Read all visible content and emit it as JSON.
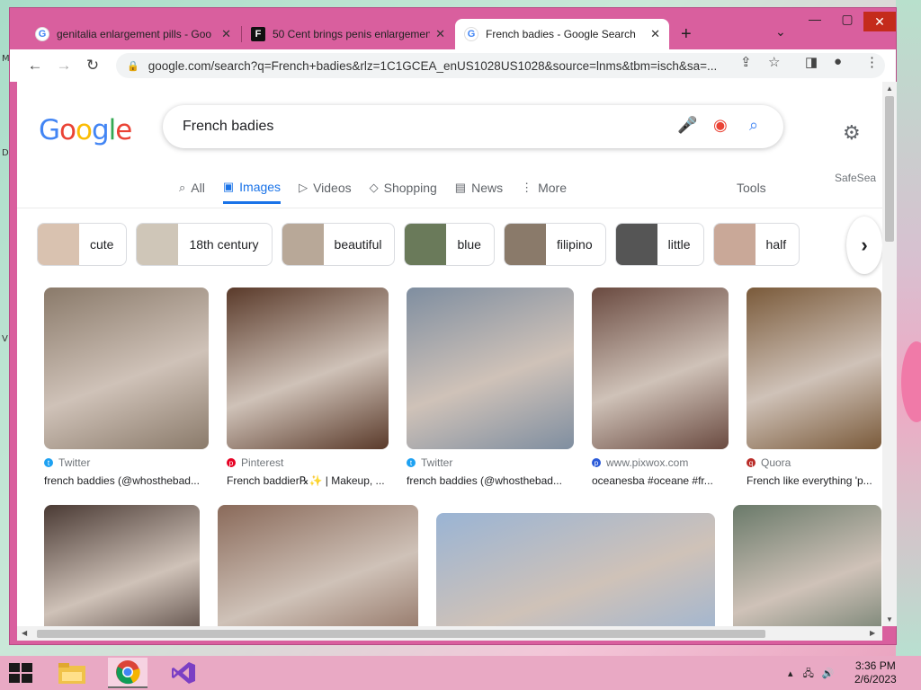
{
  "browser": {
    "tabs": [
      {
        "title": "genitalia enlargement pills - Goo",
        "favicon": "google-icon",
        "active": false
      },
      {
        "title": "50 Cent brings penis enlargemen",
        "favicon": "f-site-icon",
        "active": false
      },
      {
        "title": "French badies - Google Search",
        "favicon": "google-icon",
        "active": true
      }
    ],
    "new_tab": "+",
    "url": "google.com/search?q=French+badies&rlz=1C1GCEA_enUS1028US1028&source=lnms&tbm=isch&sa=..."
  },
  "google": {
    "logo": "Google",
    "query": "French badies",
    "nav_tabs": [
      {
        "label": "All",
        "icon": "search-icon",
        "selected": false
      },
      {
        "label": "Images",
        "icon": "image-icon",
        "selected": true
      },
      {
        "label": "Videos",
        "icon": "play-icon",
        "selected": false
      },
      {
        "label": "Shopping",
        "icon": "tag-icon",
        "selected": false
      },
      {
        "label": "News",
        "icon": "news-icon",
        "selected": false
      },
      {
        "label": "More",
        "icon": "more-vert-icon",
        "selected": false
      }
    ],
    "tools": "Tools",
    "safesearch": "SafeSea",
    "chips": [
      "cute",
      "18th century",
      "beautiful",
      "blue",
      "filipino",
      "little",
      "half"
    ],
    "results_row1": [
      {
        "source": "Twitter",
        "caption": "french baddies (@whosthebad...",
        "color": "#8a7a6a"
      },
      {
        "source": "Pinterest",
        "caption": "French baddier℞✨ | Makeup, ...",
        "color": "#5a3a2a"
      },
      {
        "source": "Twitter",
        "caption": "french baddies (@whosthebad...",
        "color": "#7f8ea0"
      },
      {
        "source": "www.pixwox.com",
        "caption": "oceanesba #oceane #fr...",
        "color": "#6a4a40"
      },
      {
        "source": "Quora",
        "caption": "French like everything 'p...",
        "color": "#7a5a3a"
      }
    ],
    "results_row2": [
      {
        "color": "#4a3a34"
      },
      {
        "color": "#8a6a5a"
      },
      {
        "color": "#9ab4d4"
      },
      {
        "color": "#6a7a6a"
      }
    ]
  },
  "taskbar": {
    "time": "3:36 PM",
    "date": "2/6/2023"
  }
}
